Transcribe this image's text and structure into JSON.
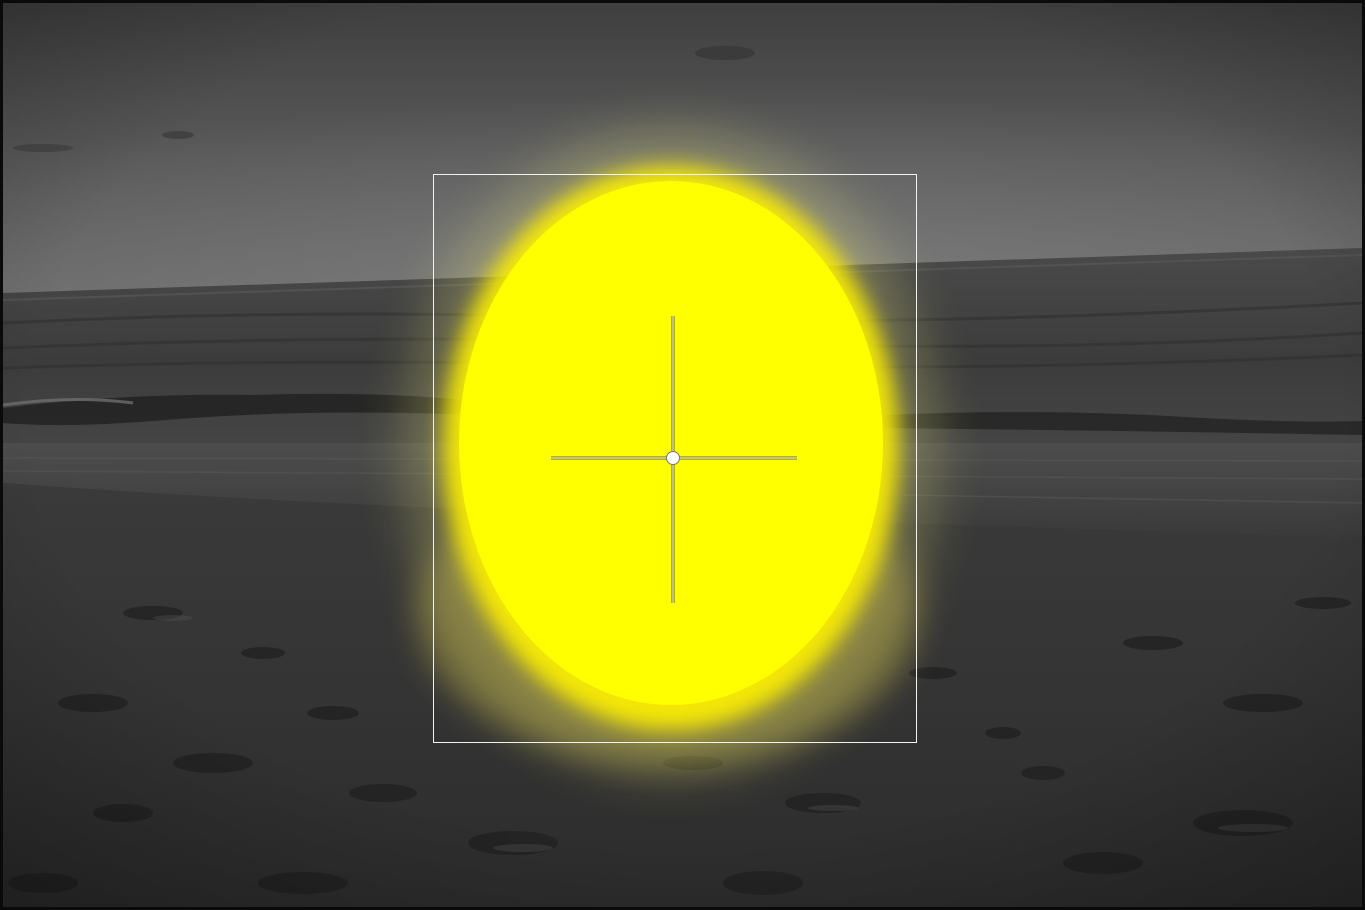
{
  "viewer": {
    "image_subject": "beach-at-dusk",
    "mode": "shape-mask-overlay",
    "overlay_color": "#ffff00",
    "bounds_color": "#f2f2f2",
    "handle_color": "#ffffff"
  },
  "icons": {
    "center_handle": "circle-handle-icon",
    "crosshair": "crosshair-icon"
  }
}
